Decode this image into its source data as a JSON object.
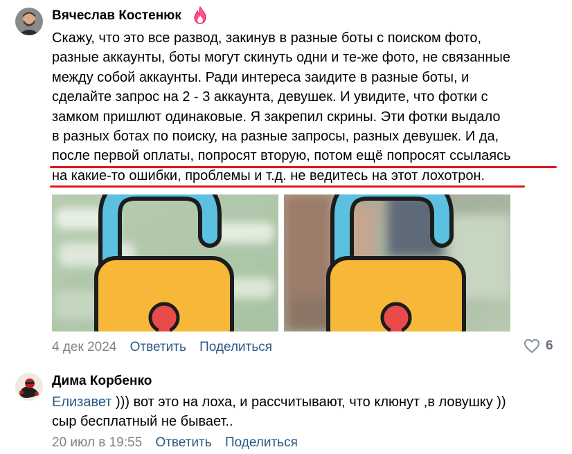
{
  "comments": [
    {
      "author": "Вячеслав Костенюк",
      "author_badge_icon": "flame-icon",
      "lines": [
        "Скажу, что это все развод, закинув в разные боты с поиском фото,",
        "разные аккаунты, боты могут скинуть одни и те-же фото, не связанные",
        "между собой аккаунты. Ради интереса заидите в разные боты, и",
        "сделайте запрос на 2 - 3 аккаунта, девушек. И увидите, что фотки с",
        "замком пришлют одинаковые. Я закрепил скрины. Эти фотки выдало",
        "в разных ботах по поиску, на разные запросы, разных девушек. И да,",
        "после первой оплаты, попросят вторую, потом ещё попросят ссылаясь",
        "на какие-то ошибки, проблемы и т.д. не ведитесь на этот лохотрон."
      ],
      "date": "4 дек 2024",
      "reply_label": "Ответить",
      "share_label": "Поделиться",
      "likes_count": "6",
      "like_icon": "heart-outline-icon",
      "attachments": [
        "lock-image-1",
        "lock-image-2"
      ]
    },
    {
      "author": "Дима Корбенко",
      "mention": "Елизавет",
      "lines": [
        " ))) вот это на лоха, и рассчитывают, что клюнут ,в ловушку ))",
        "сыр бесплатный не бывает.."
      ],
      "date": "20 июл в 19:55",
      "reply_label": "Ответить",
      "share_label": "Поделиться"
    }
  ],
  "colors": {
    "link": "#2a5885",
    "underline": "#e3151b",
    "meta_gray": "#828282",
    "lock_body": "#f7b739",
    "lock_shackle": "#5cc0e0",
    "keyhole": "#e94a4a"
  }
}
